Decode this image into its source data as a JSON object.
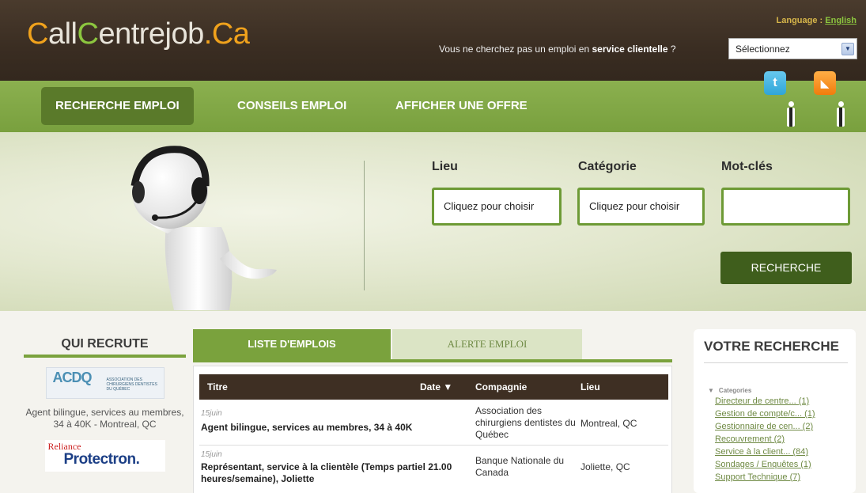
{
  "header": {
    "logo": {
      "part1": "C",
      "part2": "all",
      "part3": "C",
      "part4": "entrejob",
      "part5": ".Ca"
    },
    "language_label": "Language : ",
    "language_link": "English",
    "tagline_pre": "Vous ne cherchez pas un emploi en ",
    "tagline_bold": "service clientelle",
    "tagline_post": " ?",
    "select_value": "Sélectionnez"
  },
  "nav": {
    "items": [
      {
        "label": "RECHERCHE EMPLOI"
      },
      {
        "label": "CONSEILS EMPLOI"
      },
      {
        "label": "AFFICHER UNE OFFRE"
      }
    ],
    "social": {
      "twitter": "t",
      "rss": "◣"
    }
  },
  "search": {
    "lieu_label": "Lieu",
    "lieu_value": "Cliquez pour choisir",
    "categorie_label": "Catégorie",
    "categorie_value": "Cliquez pour choisir",
    "motcles_label": "Mot-clés",
    "motcles_value": "",
    "button": "RECHERCHE"
  },
  "left": {
    "title": "QUI RECRUTE",
    "acdq_logo": "ACDQ",
    "acdq_logo_small": "ASSOCIATION DES CHIRURGIENS DENTISTES DU QUÉBEC",
    "acdq_desc": "Agent bilingue, services au membres, 34 à 40K - Montreal, QC",
    "reliance_1": "Reliance",
    "reliance_2": "Protectron."
  },
  "tabs": {
    "list": "LISTE D'EMPLOIS",
    "alert": "ALERTE EMPLOI"
  },
  "table": {
    "headers": {
      "titre": "Titre",
      "date": "Date ▼",
      "compagnie": "Compagnie",
      "lieu": "Lieu"
    },
    "rows": [
      {
        "date": "15juin",
        "title": "Agent bilingue, services au membres, 34 à 40K",
        "company": "Association des chirurgiens dentistes du Québec",
        "location": "Montreal, QC"
      },
      {
        "date": "15juin",
        "title": "Représentant, service à la clientèle (Temps partiel 21.00 heures/semaine), Joliette",
        "company": "Banque Nationale du Canada",
        "location": "Joliette, QC"
      }
    ]
  },
  "right": {
    "title": "VOTRE RECHERCHE",
    "categories_label": "Categories",
    "categories": [
      "Directeur de centre... (1)",
      "Gestion de compte/c... (1)",
      "Gestionnaire de cen... (2)",
      "Recouvrement (2)",
      "Service à la client... (84)",
      "Sondages / Enquêtes (1)",
      "Support Technique (7)"
    ]
  }
}
